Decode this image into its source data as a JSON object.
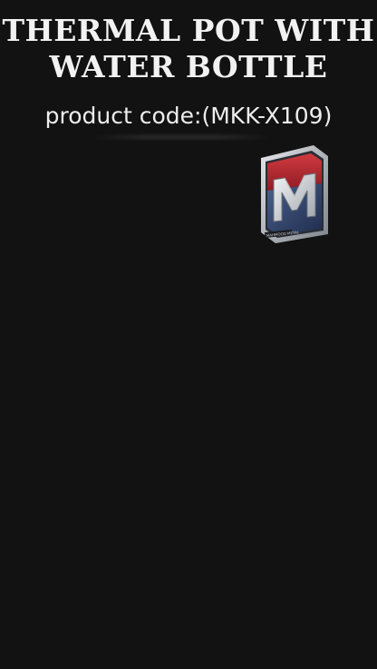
{
  "title": {
    "line1": "THERMAL POT WITH",
    "line2": "WATER BOTTLE"
  },
  "product_code": "product code:(MKK-X109)",
  "logo": {
    "icon": "m-shield-logo",
    "tiny_text": "MAHMOOD METAL",
    "colors": {
      "red": "#b3262e",
      "blue": "#31456e",
      "silver": "#cfd3d8"
    }
  }
}
